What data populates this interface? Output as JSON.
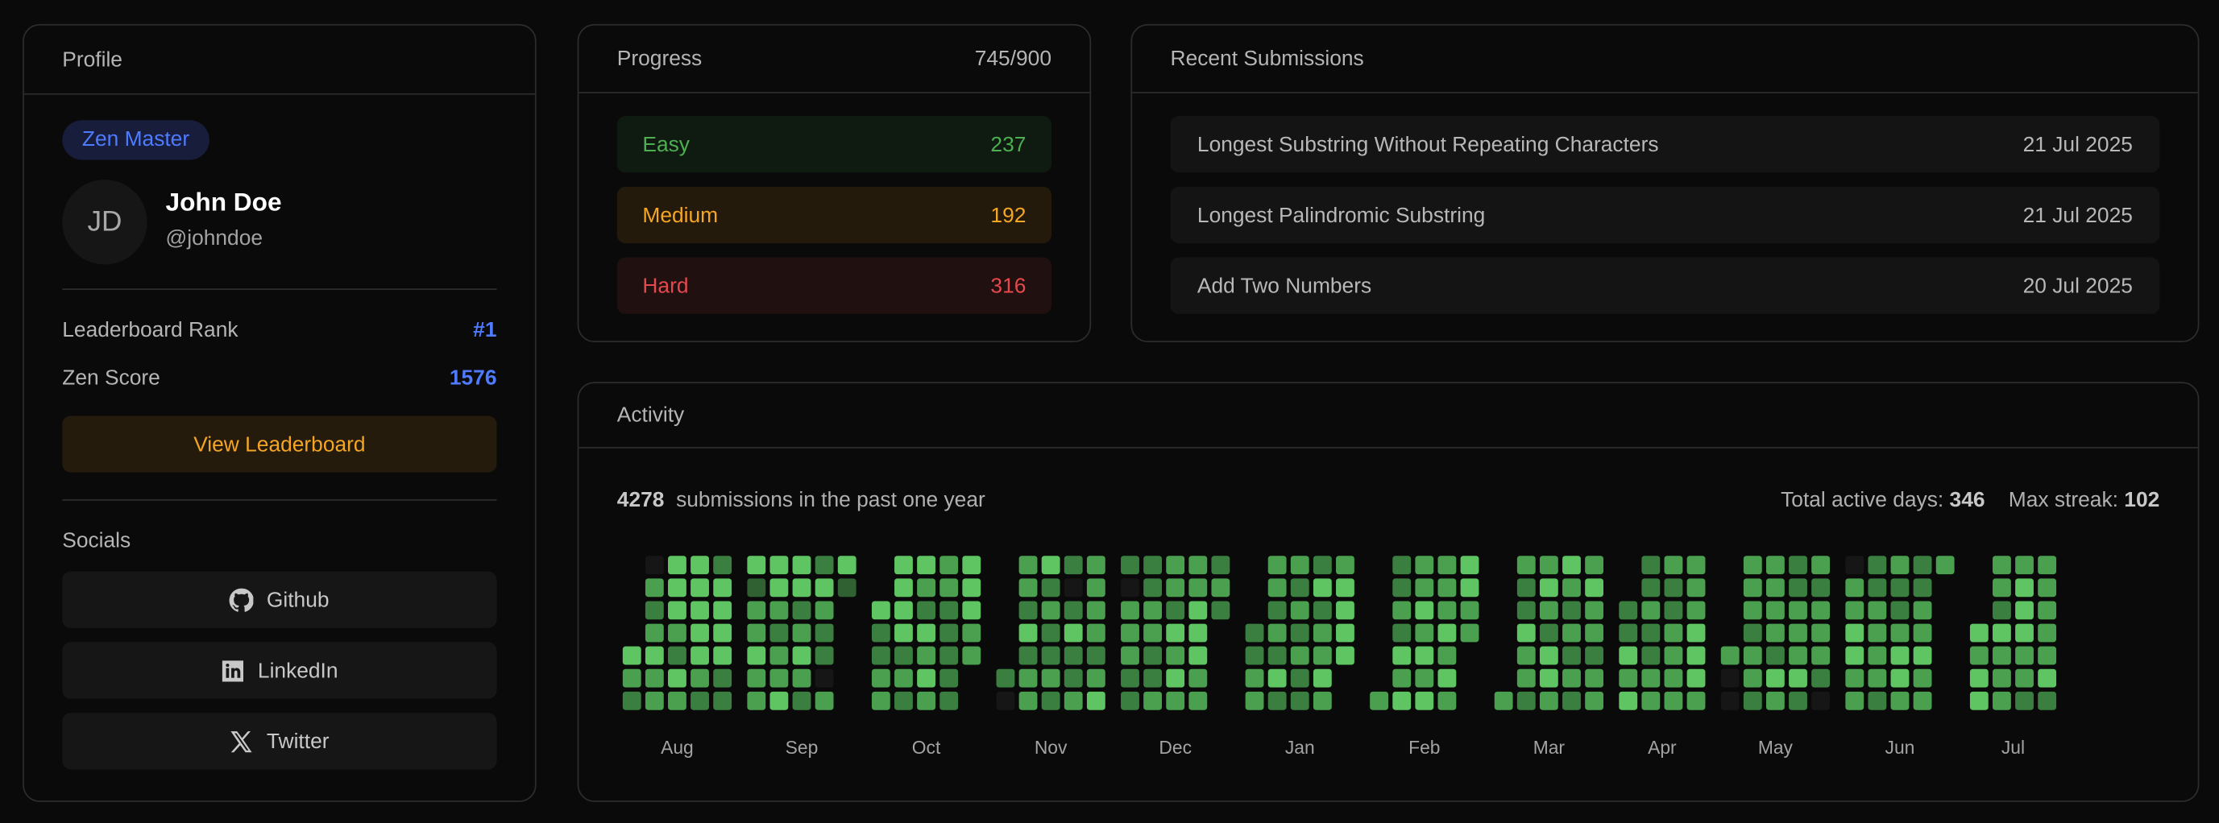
{
  "profile": {
    "title": "Profile",
    "badge": "Zen Master",
    "initials": "JD",
    "name": "John Doe",
    "handle": "@johndoe",
    "rank_label": "Leaderboard Rank",
    "rank_value": "#1",
    "score_label": "Zen Score",
    "score_value": "1576",
    "leaderboard_button": "View Leaderboard",
    "socials_title": "Socials",
    "socials": [
      {
        "label": "Github",
        "icon": "github-icon"
      },
      {
        "label": "LinkedIn",
        "icon": "linkedin-icon"
      },
      {
        "label": "Twitter",
        "icon": "x-icon"
      }
    ]
  },
  "progress": {
    "title": "Progress",
    "total": "745/900",
    "levels": [
      {
        "label": "Easy",
        "count": "237",
        "color": "#4caf50",
        "bg": "#0f1a10"
      },
      {
        "label": "Medium",
        "count": "192",
        "color": "#f5a623",
        "bg": "#231a0b"
      },
      {
        "label": "Hard",
        "count": "316",
        "color": "#e5484d",
        "bg": "#211010"
      }
    ]
  },
  "recent": {
    "title": "Recent Submissions",
    "items": [
      {
        "name": "Longest Substring Without Repeating Characters",
        "date": "21 Jul 2025"
      },
      {
        "name": "Longest Palindromic Substring",
        "date": "21 Jul 2025"
      },
      {
        "name": "Add Two Numbers",
        "date": "20 Jul 2025"
      }
    ]
  },
  "activity": {
    "title": "Activity",
    "count": "4278",
    "count_suffix": "submissions in the past one year",
    "active_label": "Total active days:",
    "active_value": "346",
    "streak_label": "Max streak:",
    "streak_value": "102",
    "level_colors": [
      "#161616",
      "#2f6133",
      "#3b7f40",
      "#4aa04f",
      "#5ec562"
    ],
    "months": [
      {
        "label": "Aug",
        "weeks": [
          "....432",
          "0323433",
          "4443243",
          "4444432",
          "2444422"
        ]
      },
      {
        "label": "Sep",
        "weeks": [
          "4133433",
          "4432334",
          "4423432",
          "2432203",
          "41....."
        ]
      },
      {
        "label": "Oct",
        "weeks": [
          "..42233",
          "4444232",
          "4324343",
          "3322222",
          "44433.."
        ]
      },
      {
        "label": "Nov",
        "weeks": [
          ".....20",
          "3324233",
          "4232232",
          "2024223",
          "3333234"
        ]
      },
      {
        "label": "Dec",
        "weeks": [
          "2033322",
          "2233223",
          "3324343",
          "3344433",
          "232...."
        ]
      },
      {
        "label": "Jan",
        "weeks": [
          "...2233",
          "3323242",
          "3232322",
          "2423343",
          "34444.."
        ]
      },
      {
        "label": "Feb",
        "weeks": [
          "......3",
          "2232434",
          "3343434",
          "3334343",
          "4433..."
        ]
      },
      {
        "label": "Mar",
        "weeks": [
          "......3",
          "3224332",
          "3432443",
          "4323232",
          "3433233"
        ]
      },
      {
        "label": "Apr",
        "weeks": [
          "..22434",
          "2232233",
          "3223333",
          "3334443"
        ]
      },
      {
        "label": "May",
        "weeks": [
          "....300",
          "3332332",
          "3333243",
          "2233342",
          "3233320"
        ]
      },
      {
        "label": "Jun",
        "weeks": [
          "0334433",
          "2233332",
          "3223443",
          "2233433",
          "3......"
        ]
      },
      {
        "label": "Jul",
        "weeks": [
          "...4344",
          "3324333",
          "3444332",
          "3333342"
        ]
      }
    ]
  }
}
